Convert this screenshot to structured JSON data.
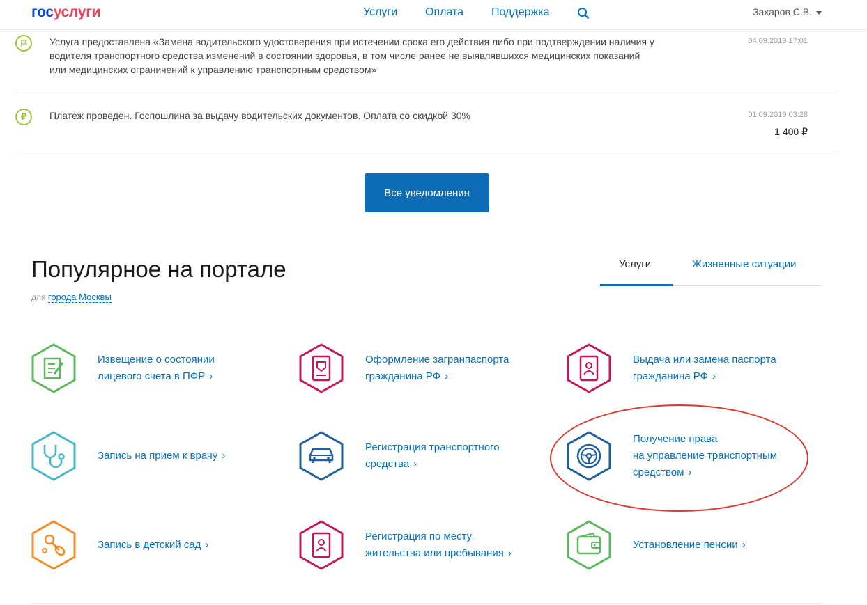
{
  "header": {
    "logo_gos": "гос",
    "logo_uslugi": "услуги",
    "nav": [
      "Услуги",
      "Оплата",
      "Поддержка"
    ],
    "user_name": "Захаров С.В."
  },
  "notifications": [
    {
      "icon": "flag-icon",
      "text": "Услуга предоставлена «Замена водительского удостоверения при истечении срока его действия либо при подтверждении наличия у водителя транспортного средства изменений в состоянии здоровья, в том числе ранее не выявлявшихся медицинских показаний или медицинских ограничений к управлению транспортным средством»",
      "date": "04.09.2019 17:01"
    },
    {
      "icon": "ruble-icon",
      "text": "Платеж проведен. Госпошлина за выдачу водительских документов. Оплата со скидкой 30%",
      "date": "01.09.2019 03:28",
      "amount": "1 400 ₽"
    }
  ],
  "all_notifications_button": "Все уведомления",
  "popular": {
    "title": "Популярное на портале",
    "region_prefix": "для",
    "region_city": "города Москвы",
    "tabs": [
      "Услуги",
      "Жизненные ситуации"
    ],
    "active_tab": "Услуги",
    "services": [
      {
        "line1": "Извещение о состоянии",
        "line2": "лицевого счета в ПФР",
        "line3": "",
        "icon": "document-edit-icon",
        "color": "#5cb85c"
      },
      {
        "line1": "Оформление загранпаспорта",
        "line2": "гражданина РФ",
        "line3": "",
        "icon": "passport-icon",
        "color": "#c2185b"
      },
      {
        "line1": "Выдача или замена паспорта",
        "line2": "гражданина РФ",
        "line3": "",
        "icon": "passport-person-icon",
        "color": "#c2185b"
      },
      {
        "line1": "Запись на прием к врачу",
        "line2": "",
        "line3": "",
        "icon": "stethoscope-icon",
        "color": "#46b6c7"
      },
      {
        "line1": "Регистрация транспортного",
        "line2": "средства",
        "line3": "",
        "icon": "car-icon",
        "color": "#1f5f9e"
      },
      {
        "line1": "Получение права",
        "line2": "на управление транспортным",
        "line3": "средством",
        "icon": "steering-wheel-icon",
        "color": "#1f5f9e"
      },
      {
        "line1": "Запись в детский сад",
        "line2": "",
        "line3": "",
        "icon": "pacifier-icon",
        "color": "#f28c28"
      },
      {
        "line1": "Регистрация по месту",
        "line2": "жительства или пребывания",
        "line3": "",
        "icon": "registration-icon",
        "color": "#c2185b"
      },
      {
        "line1": "Установление пенсии",
        "line2": "",
        "line3": "",
        "icon": "wallet-icon",
        "color": "#5cb85c"
      }
    ]
  },
  "colors": {
    "primary": "#0d6cb6",
    "link": "#0173c1",
    "highlight": "#d93a32"
  }
}
